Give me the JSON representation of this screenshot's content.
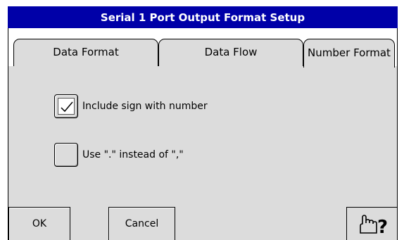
{
  "window": {
    "title": "Serial 1 Port Output Format Setup"
  },
  "tabs": [
    {
      "label": "Data Format",
      "active": false
    },
    {
      "label": "Data Flow",
      "active": false
    },
    {
      "label": "Number Format",
      "active": true
    }
  ],
  "options": {
    "include_sign": {
      "label": "Include sign with number",
      "checked": true
    },
    "use_dot": {
      "label": "Use \".\" instead of \",\"",
      "checked": false
    }
  },
  "buttons": {
    "ok": "OK",
    "cancel": "Cancel",
    "help_icon": "hand-question-icon",
    "help_glyph": "?"
  },
  "colors": {
    "titlebar": "#0000a8",
    "panel": "#dcdcdc"
  }
}
